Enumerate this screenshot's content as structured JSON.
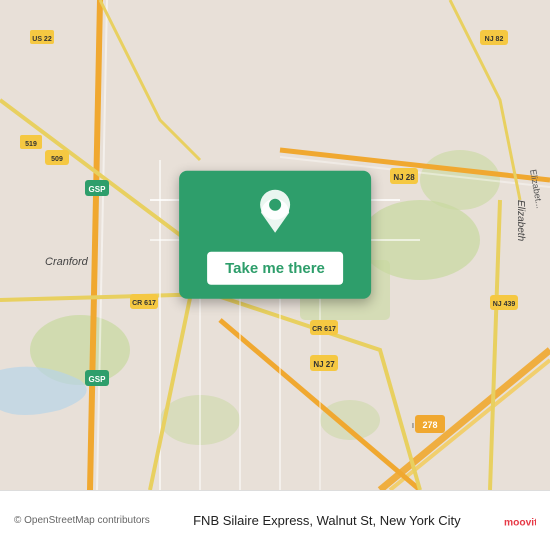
{
  "map": {
    "background_color": "#e8e0d8",
    "road_color": "#f5c842",
    "highway_color": "#f0a830",
    "green_color": "#c8d8a0"
  },
  "popup": {
    "background": "#2e9e6b",
    "button_label": "Take me there"
  },
  "bottom": {
    "copyright": "© OpenStreetMap contributors",
    "location": "FNB Silaire Express, Walnut St, New York City"
  },
  "icons": {
    "pin": "📍",
    "moovit_text": "moovit"
  }
}
